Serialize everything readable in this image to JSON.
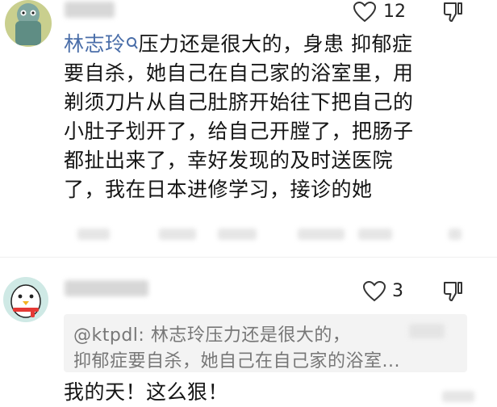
{
  "comments": [
    {
      "username": "",
      "author": "林志玲",
      "likes": "12",
      "lines": [
        "压力还是很大的，身患 抑郁症",
        "要自杀，她自己在自己家的浴室里，用",
        "剃须刀片从自己肚脐开始往下把自己的",
        "小肚子划开了，给自己开膛了，把肠子",
        "都扯出来了，幸好发现的及时送医院",
        "了，我在日本进修学习，接诊的她"
      ],
      "icons": [
        "user-avatar-icon",
        "verified-icon",
        "heart-icon",
        "dislike-icon"
      ]
    },
    {
      "username": "",
      "likes": "3",
      "quote_lines": [
        "@ktpdl: 林志玲压力还是很大的，",
        "抑郁症要自杀，她自己在自己家的浴室..."
      ],
      "text": "我的天！这么狠！",
      "icons": [
        "penguin-avatar-icon",
        "heart-icon",
        "dislike-icon"
      ]
    }
  ],
  "colors": {
    "author_name": "#4a6ea9",
    "text": "#151515",
    "quote_bg": "#f3f3f3",
    "quote_text": "#777777",
    "blur": "#d3d3d3"
  }
}
